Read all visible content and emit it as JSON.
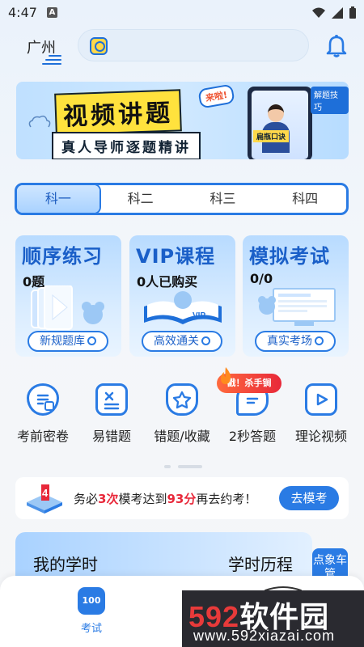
{
  "status_bar": {
    "time": "4:47",
    "notification_icon": "A"
  },
  "header": {
    "city": "广州",
    "search_placeholder": "",
    "icons": {
      "search": "search-icon",
      "bell": "bell-icon"
    }
  },
  "banner": {
    "title": "视频讲题",
    "subtitle": "真人导师逐题精讲",
    "tag": "来啦!",
    "phone_label": "扁瓶口诀",
    "tip": "解题技巧"
  },
  "subject_tabs": {
    "items": [
      "科一",
      "科二",
      "科三",
      "科四"
    ],
    "selected": "科一"
  },
  "cards": [
    {
      "title": "顺序练习",
      "count": "0题",
      "button": "新规题库"
    },
    {
      "title": "VIP课程",
      "count": "0人已购买",
      "button": "高效通关"
    },
    {
      "title": "模拟考试",
      "count": "0/0",
      "button": "真实考场"
    }
  ],
  "shortcuts": [
    {
      "label": "考前密卷",
      "icon": "document-icon"
    },
    {
      "label": "易错题",
      "icon": "error-list-icon"
    },
    {
      "label": "错题/收藏",
      "icon": "star-shield-icon"
    },
    {
      "label": "2秒答题",
      "icon": "chat-bubble-icon"
    },
    {
      "label": "理论视频",
      "icon": "video-play-icon"
    }
  ],
  "hot_badge": "戳！杀手锏",
  "reminder": {
    "text_prefix": "务必",
    "times": "3次",
    "text_mid": "模考达到",
    "score": "93分",
    "text_suffix": "再去约考！",
    "button": "去模考"
  },
  "study": {
    "title": "我的学时",
    "history": "学时历程",
    "faded_text": "",
    "side_tab": "点象车管"
  },
  "bottom_nav": {
    "items": [
      {
        "label": "考试",
        "icon_text": "100"
      }
    ]
  },
  "watermark": {
    "brand_num": "592",
    "brand_text": "软件园",
    "url": "www.592xiazai.com"
  },
  "colors": {
    "accent": "#2a7be4",
    "highlight": "#e8283a",
    "banner_yellow": "#ffe23d"
  }
}
